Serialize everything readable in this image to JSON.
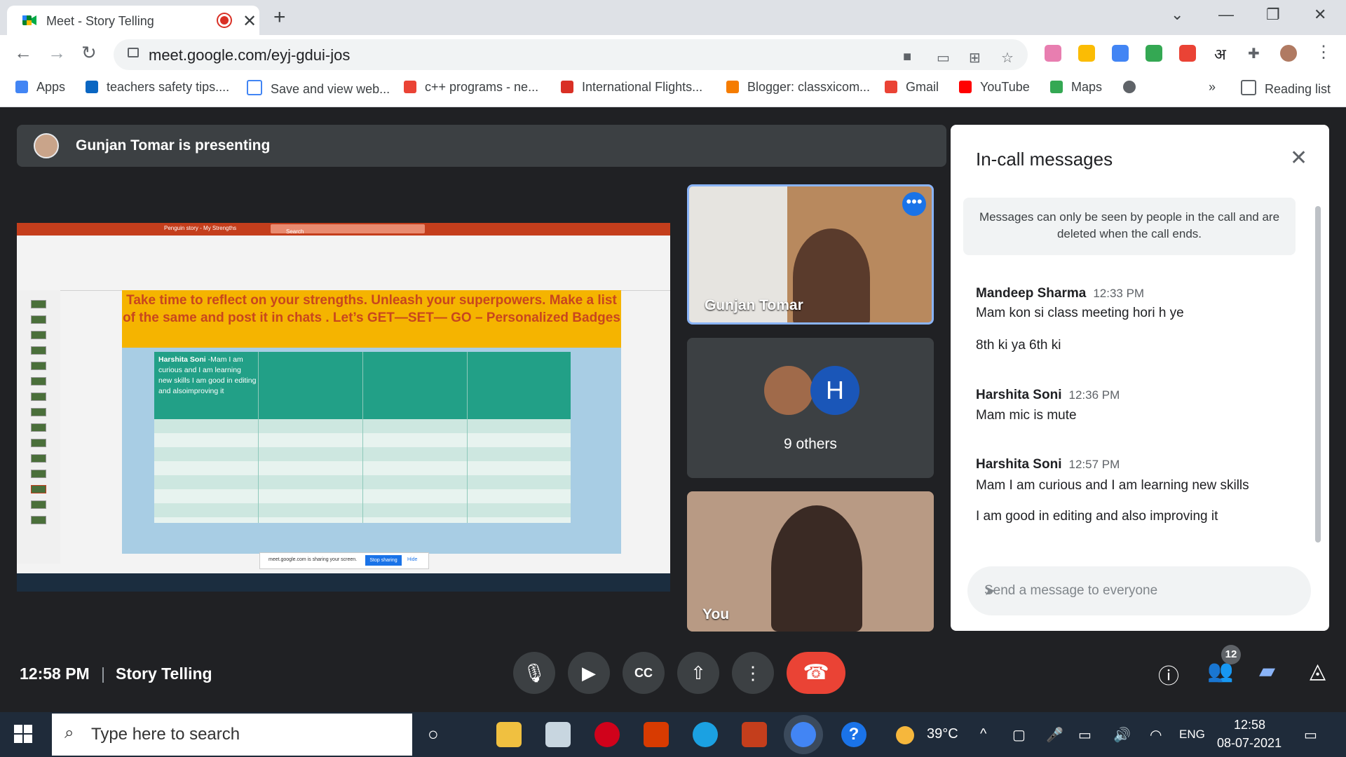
{
  "browser": {
    "tab_title": "Meet - Story Telling",
    "url": "meet.google.com/eyj-gdui-jos",
    "bookmarks": [
      "Apps",
      "teachers safety tips....",
      "Save and view web...",
      "c++ programs - ne...",
      "International Flights...",
      "Blogger: classxicom...",
      "Gmail",
      "YouTube",
      "Maps"
    ],
    "reading_list": "Reading list",
    "overflow": "»"
  },
  "meet": {
    "presenter_text": "Gunjan Tomar is presenting",
    "slide": {
      "heading": "Take time to reflect on your strengths. Unleash your superpowers. Make a list of the same and post it in chats . Let’s GET—SET— GO – Personalized Badges",
      "cell_author": "Harshita Soni",
      "cell_text": " -Mam I am curious and I am learning new skills I am good in editing and alsoimproving it",
      "share_notice": "meet.google.com is sharing your screen.",
      "stop_sharing": "Stop sharing",
      "hide": "Hide",
      "ppt_title": "Penguin story - My Strengths",
      "ppt_search": "Search"
    },
    "tiles": {
      "presenter_name": "Gunjan Tomar",
      "others_label": "9 others",
      "others_initial": "H",
      "self_label": "You"
    },
    "chat": {
      "header": "In-call messages",
      "notice": "Messages can only be seen by people in the call and are deleted when the call ends.",
      "messages": [
        {
          "name": "Mandeep Sharma",
          "time": "12:33 PM",
          "lines": [
            "Mam kon si class meeting hori h ye",
            "8th ki ya 6th ki"
          ]
        },
        {
          "name": "Harshita Soni",
          "time": "12:36 PM",
          "lines": [
            "Mam mic is mute"
          ]
        },
        {
          "name": "Harshita Soni",
          "time": "12:57 PM",
          "lines": [
            "Mam I am curious and I am learning new skills",
            "I am good in editing and also improving it"
          ]
        }
      ],
      "input_placeholder": "Send a message to everyone"
    },
    "bottom": {
      "time": "12:58 PM",
      "separator": "|",
      "meeting_name": "Story Telling",
      "people_count": "12"
    }
  },
  "taskbar": {
    "search_placeholder": "Type here to search",
    "weather": "39°C",
    "language": "ENG",
    "clock_time": "12:58",
    "clock_date": "08-07-2021"
  },
  "colors": {
    "meet_bg": "#202124",
    "leave_red": "#ea4335",
    "slide_orange": "#f5b400",
    "table_teal": "#22a087",
    "accent_blue": "#8ab4f8"
  }
}
